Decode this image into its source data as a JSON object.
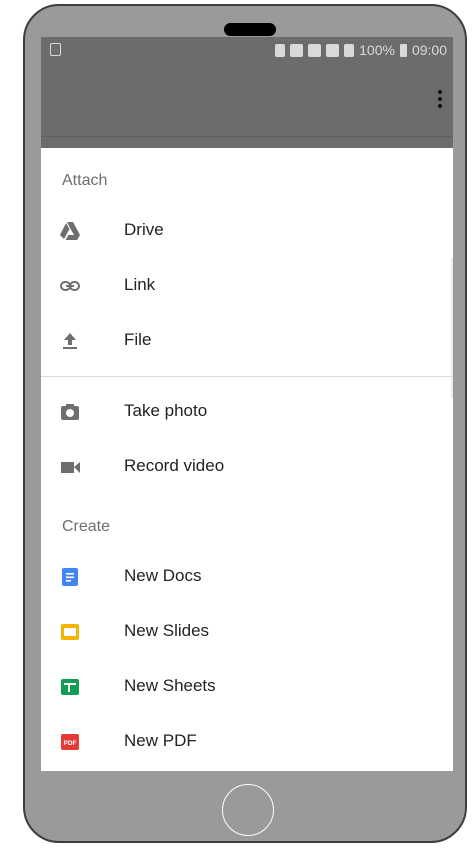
{
  "status_bar": {
    "battery_percent": "100%",
    "time": "09:00"
  },
  "sheet": {
    "attach_header": "Attach",
    "attach_items": [
      {
        "label": "Drive",
        "icon": "drive-icon"
      },
      {
        "label": "Link",
        "icon": "link-icon"
      },
      {
        "label": "File",
        "icon": "upload-icon"
      }
    ],
    "capture_items": [
      {
        "label": "Take photo",
        "icon": "camera-icon"
      },
      {
        "label": "Record video",
        "icon": "videocam-icon"
      }
    ],
    "create_header": "Create",
    "create_items": [
      {
        "label": "New Docs",
        "icon": "docs-icon",
        "color": "#4285F4"
      },
      {
        "label": "New Slides",
        "icon": "slides-icon",
        "color": "#F4B400"
      },
      {
        "label": "New Sheets",
        "icon": "sheets-icon",
        "color": "#0F9D58"
      },
      {
        "label": "New PDF",
        "icon": "pdf-icon",
        "color": "#E53935",
        "badge": "PDF"
      }
    ]
  }
}
